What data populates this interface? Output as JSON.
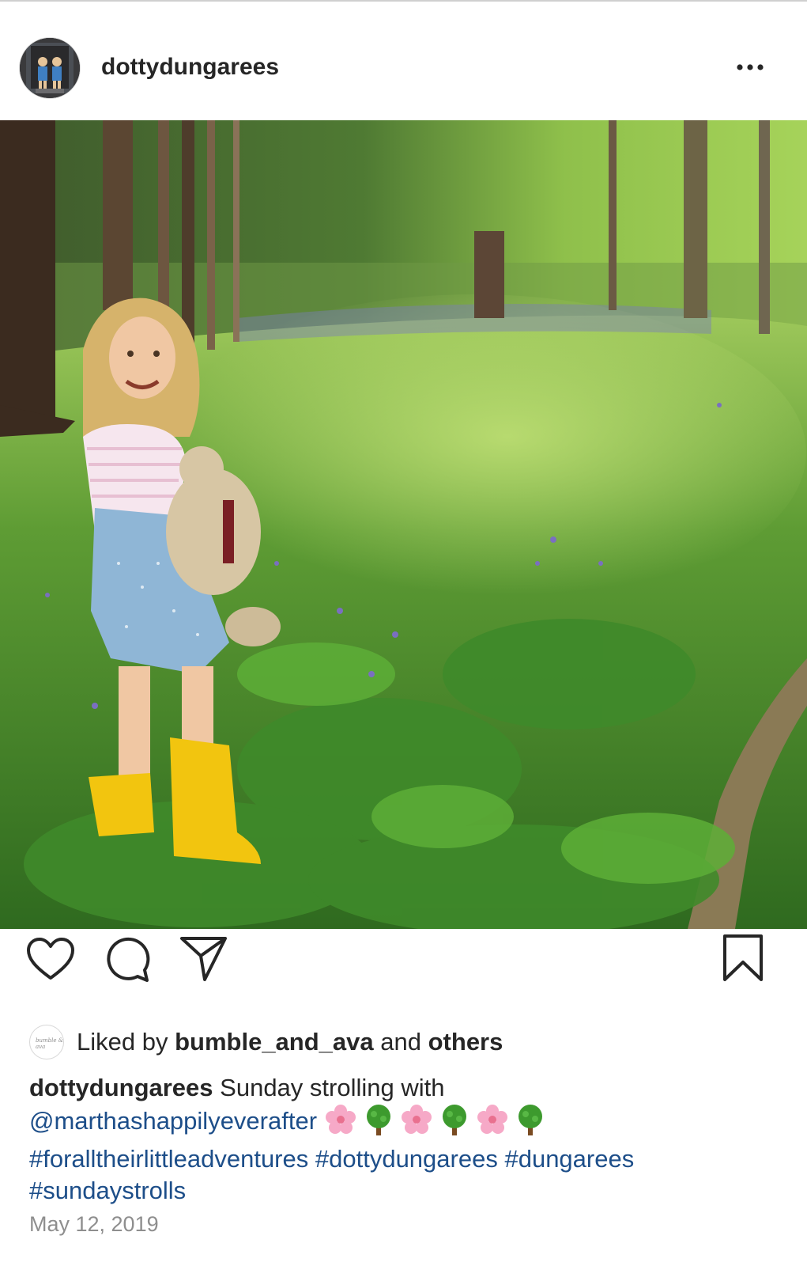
{
  "post": {
    "username": "dottydungarees",
    "more_label": "•••",
    "photo_icon": "photo-girl-in-bluebell-woods",
    "likes": {
      "prefix": "Liked by",
      "liker": "bumble_and_ava",
      "connector": "and",
      "others": "others",
      "liker_avatar_text": "bumble & ava"
    },
    "caption": {
      "username": "dottydungarees",
      "text": "Sunday strolling with",
      "mention": "@marthashappilyeverafter",
      "emojis": [
        "cherry-blossom-icon",
        "tree-icon",
        "cherry-blossom-icon",
        "tree-icon",
        "cherry-blossom-icon",
        "tree-icon"
      ],
      "hashtags": [
        "#foralltheirlittleadventures",
        "#dottydungarees",
        "#dungarees",
        "#sundaystrolls"
      ]
    },
    "date": "May 12, 2019"
  },
  "colors": {
    "link": "#1d4e89",
    "text": "#262626",
    "muted": "#8e8e8e"
  }
}
